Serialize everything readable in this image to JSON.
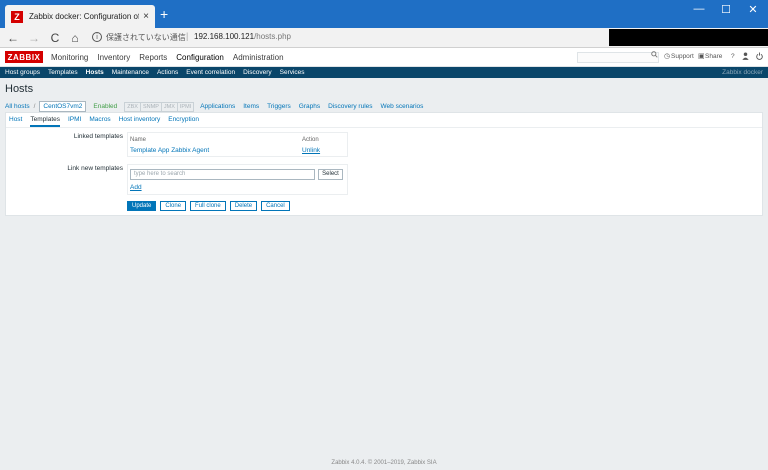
{
  "browser": {
    "tab_title": "Zabbix docker: Configuration of",
    "tab_favicon": "Z",
    "close_glyph": "×",
    "newtab_glyph": "+",
    "win_minimize": "—",
    "win_maximize": "☐",
    "win_close": "✕",
    "back": "←",
    "forward": "→",
    "reload": "C",
    "home": "⌂",
    "info": "i",
    "security_text": "保護されていない通信",
    "separator": "|",
    "url_host": "192.168.100.121",
    "url_path": "/hosts.php"
  },
  "header": {
    "logo": "ZABBIX",
    "menu": [
      "Monitoring",
      "Inventory",
      "Reports",
      "Configuration",
      "Administration"
    ],
    "support": "Support",
    "share": "Share",
    "help": "?",
    "user_icon": "user-icon",
    "power_icon": "power-icon"
  },
  "submenu": {
    "items": [
      "Host groups",
      "Templates",
      "Hosts",
      "Maintenance",
      "Actions",
      "Event correlation",
      "Discovery",
      "Services"
    ],
    "server_name": "Zabbix docker"
  },
  "page": {
    "title": "Hosts"
  },
  "breadcrumb": {
    "all_hosts": "All hosts",
    "sep": "/",
    "host": "CentOS7vm2",
    "status": "Enabled",
    "availability": [
      "ZBX",
      "SNMP",
      "JMX",
      "IPMI"
    ],
    "links": [
      "Applications",
      "Items",
      "Triggers",
      "Graphs",
      "Discovery rules",
      "Web scenarios"
    ]
  },
  "tabs": [
    "Host",
    "Templates",
    "IPMI",
    "Macros",
    "Host inventory",
    "Encryption"
  ],
  "form": {
    "linked_label": "Linked templates",
    "col_name": "Name",
    "col_action": "Action",
    "linked_template": "Template App Zabbix Agent",
    "unlink": "Unlink",
    "link_new_label": "Link new templates",
    "search_placeholder": "type here to search",
    "select_btn": "Select",
    "add_link": "Add"
  },
  "buttons": {
    "update": "Update",
    "clone": "Clone",
    "full_clone": "Full clone",
    "delete": "Delete",
    "cancel": "Cancel"
  },
  "footer": "Zabbix 4.0.4. © 2001–2019, Zabbix SIA"
}
